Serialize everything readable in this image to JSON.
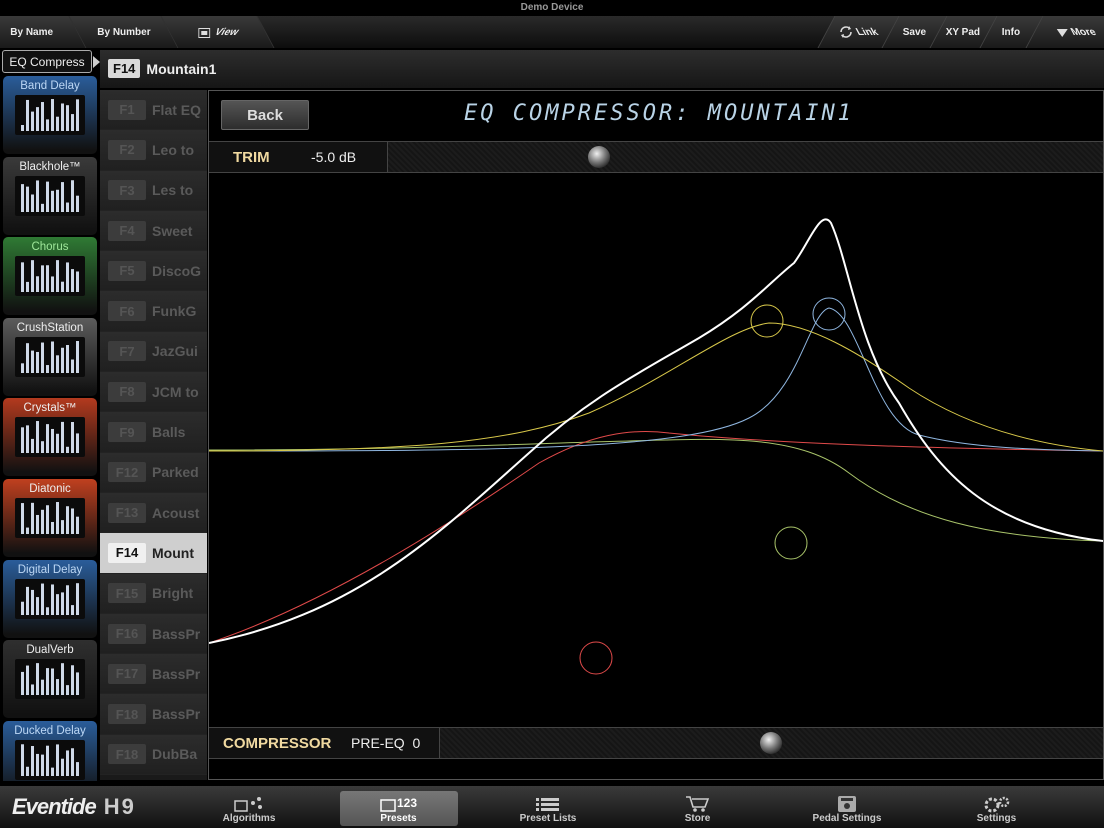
{
  "device_title": "Demo Device",
  "topbar": {
    "by_name": "By Name",
    "by_number": "By Number",
    "view": "View",
    "link": "Link",
    "save": "Save",
    "xy_pad": "XY Pad",
    "info": "Info",
    "more": "More"
  },
  "algorithm_tab": "EQ Compress",
  "current_preset": {
    "number": "F14",
    "name": "Mountain1"
  },
  "algorithms": [
    {
      "label": "Band Delay",
      "color": "#2a5d9a"
    },
    {
      "label": "Blackhole™",
      "color": "#3a3a3a"
    },
    {
      "label": "Chorus",
      "color": "#2f7a34"
    },
    {
      "label": "CrushStation",
      "color": "#5c5c5c"
    },
    {
      "label": "Crystals™",
      "color": "#b33a1e"
    },
    {
      "label": "Diatonic",
      "color": "#c0401f"
    },
    {
      "label": "Digital Delay",
      "color": "#2a5d9a"
    },
    {
      "label": "DualVerb",
      "color": "#2f2f2f"
    },
    {
      "label": "Ducked Delay",
      "color": "#2a5d9a"
    }
  ],
  "presets": [
    {
      "number": "F1",
      "name": "Flat EQ"
    },
    {
      "number": "F2",
      "name": "Leo to"
    },
    {
      "number": "F3",
      "name": "Les to"
    },
    {
      "number": "F4",
      "name": "Sweet"
    },
    {
      "number": "F5",
      "name": "DiscoG"
    },
    {
      "number": "F6",
      "name": "FunkG"
    },
    {
      "number": "F7",
      "name": "JazGui"
    },
    {
      "number": "F8",
      "name": "JCM to"
    },
    {
      "number": "F9",
      "name": "Balls"
    },
    {
      "number": "F12",
      "name": "Parked"
    },
    {
      "number": "F13",
      "name": "Acoust"
    },
    {
      "number": "F14",
      "name": "Mount"
    },
    {
      "number": "F15",
      "name": "Bright"
    },
    {
      "number": "F16",
      "name": "BassPr"
    },
    {
      "number": "F17",
      "name": "BassPr"
    },
    {
      "number": "F18",
      "name": "BassPr"
    },
    {
      "number": "F18",
      "name": "DubBa"
    }
  ],
  "selected_preset_index": 11,
  "main": {
    "back_label": "Back",
    "heading": "EQ COMPRESSOR: MOUNTAIN1",
    "trim_label": "TRIM",
    "trim_value": "-5.0 dB",
    "compressor_label": "COMPRESSOR",
    "compressor_value": "PRE-EQ  0"
  },
  "eq_band_colors": {
    "total": "#ffffff",
    "band1": "#e04a4a",
    "band2": "#d8c84a",
    "band3": "#8fb6e0",
    "band4": "#a9c46a"
  },
  "footer": {
    "logo": "Eventide",
    "model": "H9",
    "tabs": [
      {
        "label": "Algorithms",
        "icon": "algorithms-icon"
      },
      {
        "label": "Presets",
        "icon": "presets-icon"
      },
      {
        "label": "Preset Lists",
        "icon": "list-icon"
      },
      {
        "label": "Store",
        "icon": "cart-icon"
      },
      {
        "label": "Pedal Settings",
        "icon": "pedal-icon"
      },
      {
        "label": "Settings",
        "icon": "gear-icon"
      }
    ],
    "active_tab": 1
  }
}
